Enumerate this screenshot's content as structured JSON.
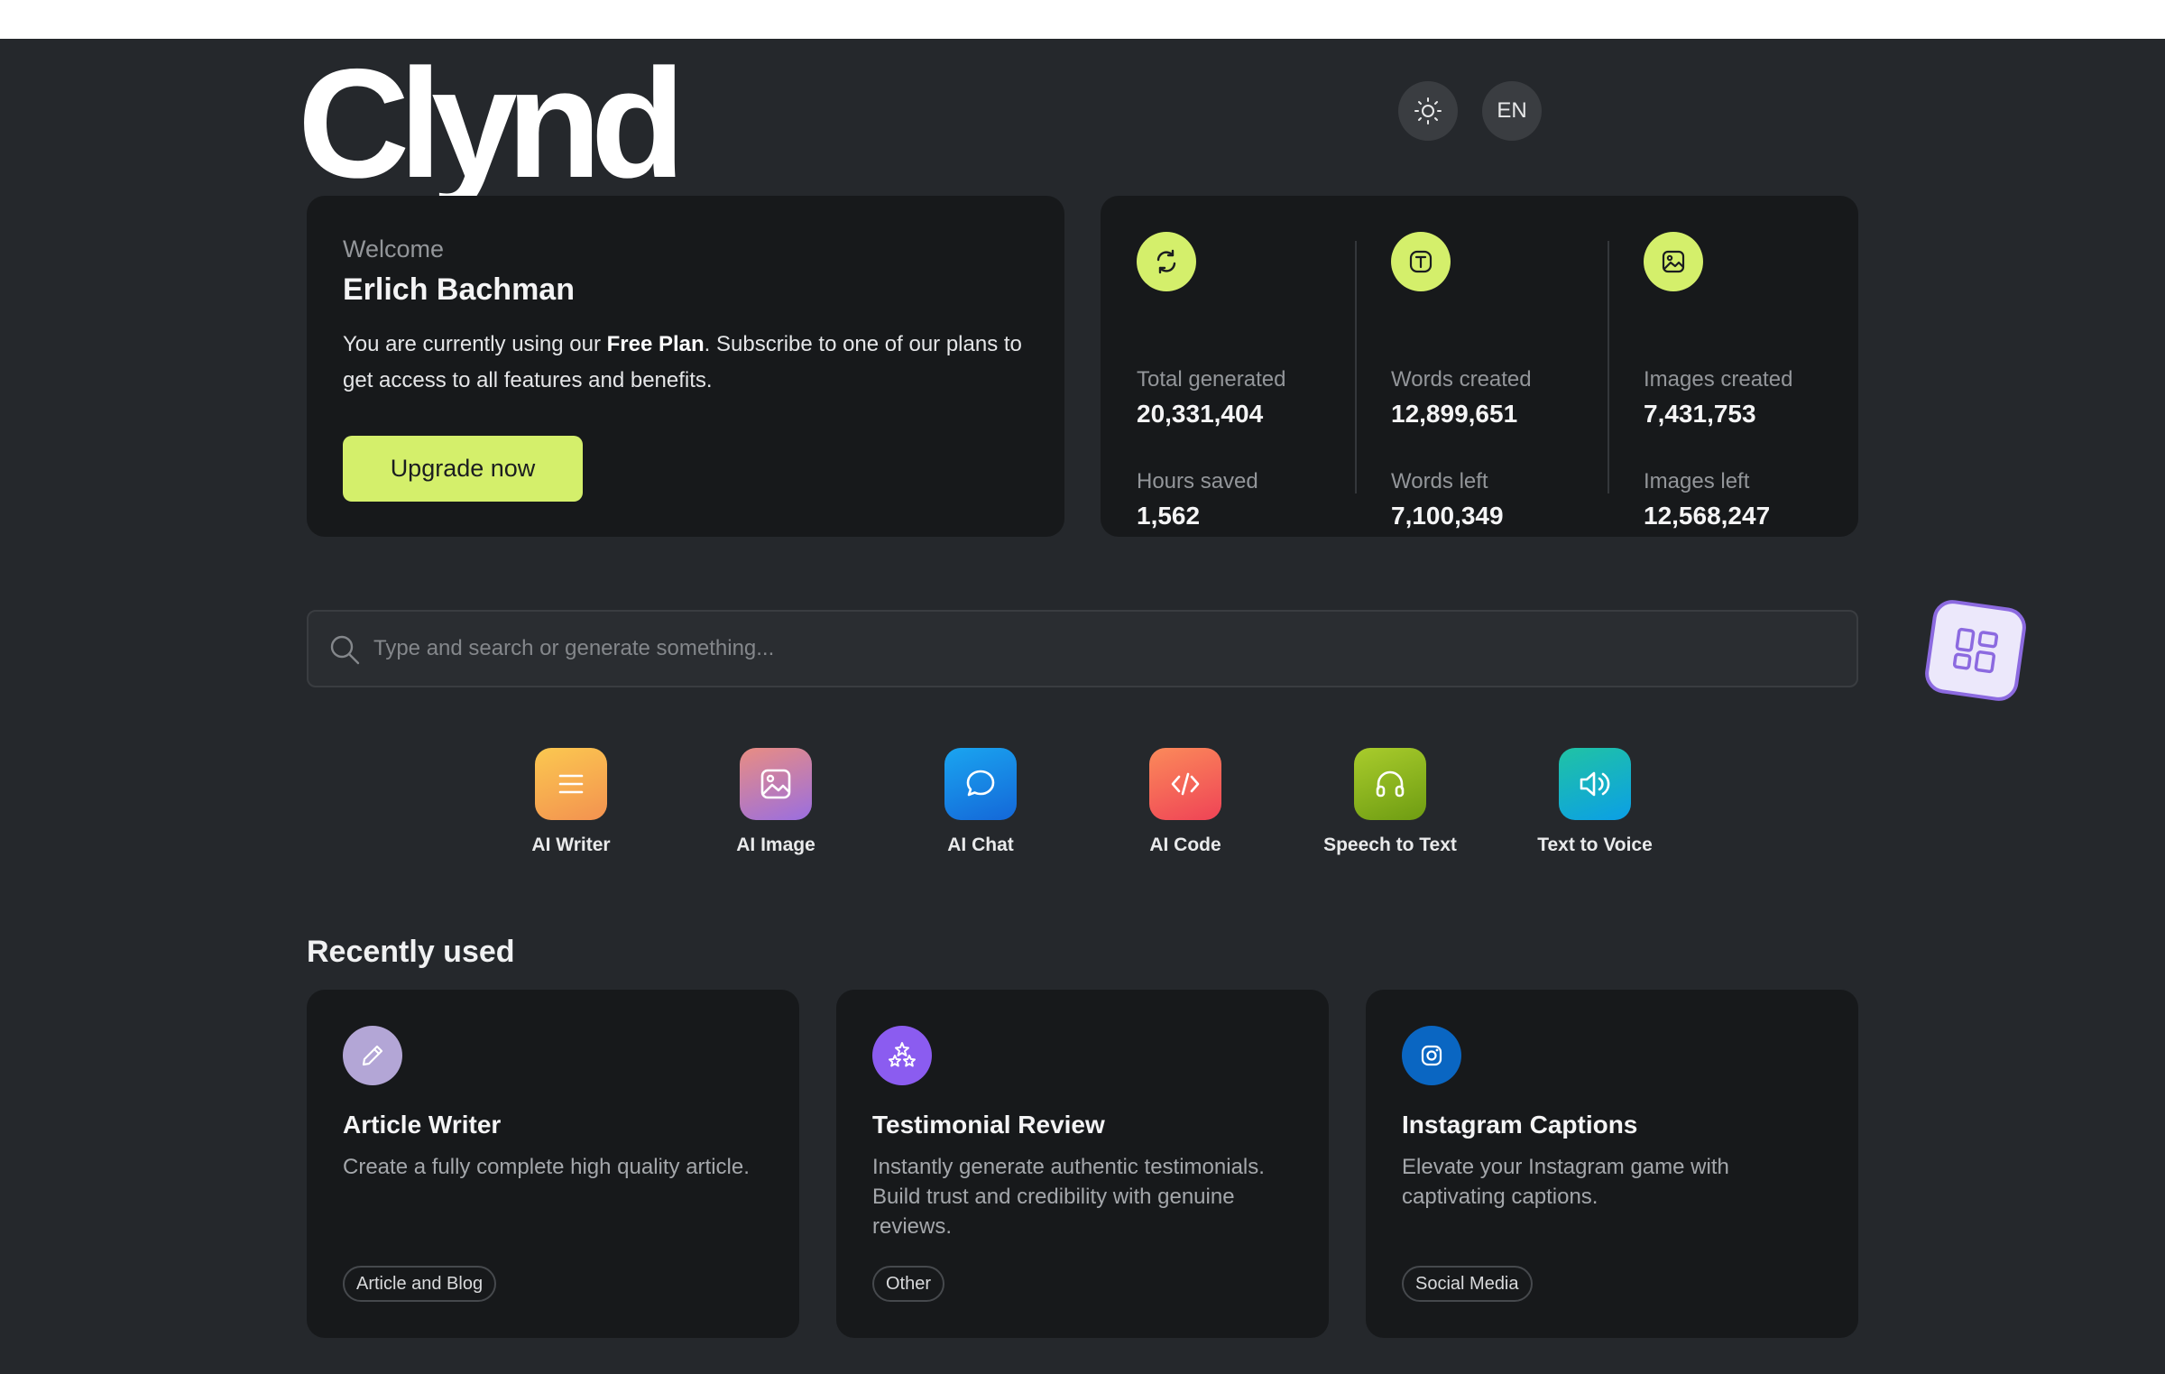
{
  "header": {
    "logo": "Clynd",
    "theme_icon": "sun-icon",
    "language": "EN"
  },
  "welcome": {
    "label": "Welcome",
    "name": "Erlich Bachman",
    "text_before": "You are currently using our ",
    "plan": "Free Plan",
    "text_after": ". Subscribe to one of our plans to get access to all features and benefits.",
    "button": "Upgrade now"
  },
  "stats": [
    {
      "icon": "refresh-icon",
      "label1": "Total generated",
      "value1": "20,331,404",
      "label2": "Hours saved",
      "value2": "1,562"
    },
    {
      "icon": "text-icon",
      "label1": "Words created",
      "value1": "12,899,651",
      "label2": "Words left",
      "value2": "7,100,349"
    },
    {
      "icon": "image-icon",
      "label1": "Images created",
      "value1": "7,431,753",
      "label2": "Images left",
      "value2": "12,568,247"
    }
  ],
  "search": {
    "placeholder": "Type and search or generate something..."
  },
  "tools": [
    {
      "label": "AI Writer",
      "icon": "lines-icon",
      "color": "#f7a94e"
    },
    {
      "label": "AI Image",
      "icon": "image-icon",
      "color": "#b27ad8"
    },
    {
      "label": "AI Chat",
      "icon": "chat-bubble-icon",
      "color": "#1f8ee8"
    },
    {
      "label": "AI Code",
      "icon": "code-icon",
      "color": "#f45d4f"
    },
    {
      "label": "Speech to Text",
      "icon": "headphones-icon",
      "color": "#8dbb1b"
    },
    {
      "label": "Text to Voice",
      "icon": "speaker-icon",
      "color": "#17b4d0"
    }
  ],
  "recent": {
    "title": "Recently used",
    "items": [
      {
        "title": "Article Writer",
        "description": "Create a fully complete high quality article.",
        "tag": "Article and Blog",
        "icon": "pencil-icon",
        "color": "#b3a6d6"
      },
      {
        "title": "Testimonial Review",
        "description": "Instantly generate authentic testimonials. Build trust and credibility with genuine reviews.",
        "tag": "Other",
        "icon": "stars-icon",
        "color": "#8b5cf0"
      },
      {
        "title": "Instagram Captions",
        "description": "Elevate your Instagram game with captivating captions.",
        "tag": "Social Media",
        "icon": "instagram-icon",
        "color": "#0a66c2"
      }
    ]
  },
  "colors": {
    "accent": "#d4ef6b",
    "background": "#25282c",
    "card": "#17191b"
  }
}
